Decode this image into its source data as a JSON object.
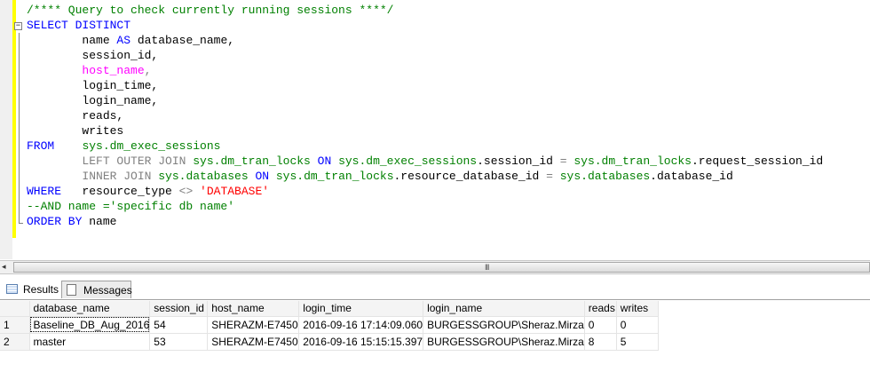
{
  "editor": {
    "fold_icon": "collapse-minus-icon",
    "lines": [
      [
        {
          "t": "/**** Query to check currently running sessions ****/",
          "c": "cm"
        }
      ],
      [
        {
          "t": "SELECT DISTINCT",
          "c": "kw"
        }
      ],
      [
        {
          "t": "        name ",
          "c": "plain"
        },
        {
          "t": "AS",
          "c": "kw"
        },
        {
          "t": " database_name,",
          "c": "plain"
        }
      ],
      [
        {
          "t": "        session_id,",
          "c": "plain"
        }
      ],
      [
        {
          "t": "        ",
          "c": "plain"
        },
        {
          "t": "host_name",
          "c": "fn"
        },
        {
          "t": ",",
          "c": "gray"
        }
      ],
      [
        {
          "t": "        login_time,",
          "c": "plain"
        }
      ],
      [
        {
          "t": "        login_name,",
          "c": "plain"
        }
      ],
      [
        {
          "t": "        reads,",
          "c": "plain"
        }
      ],
      [
        {
          "t": "        writes",
          "c": "plain"
        }
      ],
      [
        {
          "t": "FROM",
          "c": "kw"
        },
        {
          "t": "    ",
          "c": "plain"
        },
        {
          "t": "sys.dm_exec_sessions",
          "c": "sys"
        }
      ],
      [
        {
          "t": "        LEFT OUTER JOIN ",
          "c": "gray"
        },
        {
          "t": "sys.dm_tran_locks",
          "c": "sys"
        },
        {
          "t": " ON ",
          "c": "kw"
        },
        {
          "t": "sys.dm_exec_sessions",
          "c": "sys"
        },
        {
          "t": ".session_id ",
          "c": "plain"
        },
        {
          "t": "=",
          "c": "gray"
        },
        {
          "t": " sys.dm_tran_locks",
          "c": "sys"
        },
        {
          "t": ".request_session_id",
          "c": "plain"
        }
      ],
      [
        {
          "t": "        INNER JOIN ",
          "c": "gray"
        },
        {
          "t": "sys.databases",
          "c": "sys"
        },
        {
          "t": " ON ",
          "c": "kw"
        },
        {
          "t": "sys.dm_tran_locks",
          "c": "sys"
        },
        {
          "t": ".resource_database_id ",
          "c": "plain"
        },
        {
          "t": "=",
          "c": "gray"
        },
        {
          "t": " sys.databases",
          "c": "sys"
        },
        {
          "t": ".database_id",
          "c": "plain"
        }
      ],
      [
        {
          "t": "WHERE",
          "c": "kw"
        },
        {
          "t": "   resource_type ",
          "c": "plain"
        },
        {
          "t": "<>",
          "c": "gray"
        },
        {
          "t": " 'DATABASE'",
          "c": "str"
        }
      ],
      [
        {
          "t": "--AND name ='specific db name'",
          "c": "cm"
        }
      ],
      [
        {
          "t": "ORDER BY",
          "c": "kw"
        },
        {
          "t": " name",
          "c": "plain"
        }
      ]
    ]
  },
  "scrollbar": {
    "left_arrow": "◂",
    "grip": "III"
  },
  "tabs": [
    {
      "label": "Results",
      "icon": "grid-icon",
      "active": true
    },
    {
      "label": "Messages",
      "icon": "messages-icon",
      "active": false
    }
  ],
  "results": {
    "columns": [
      "database_name",
      "session_id",
      "host_name",
      "login_time",
      "login_name",
      "reads",
      "writes"
    ],
    "rows": [
      [
        "1",
        "Baseline_DB_Aug_2016",
        "54",
        "SHERAZM-E7450",
        "2016-09-16 17:14:09.060",
        "BURGESSGROUP\\Sheraz.Mirza",
        "0",
        "0"
      ],
      [
        "2",
        "master",
        "53",
        "SHERAZM-E7450",
        "2016-09-16 15:15:15.397",
        "BURGESSGROUP\\Sheraz.Mirza",
        "8",
        "5"
      ]
    ]
  },
  "colors": {
    "keyword": "#0000ff",
    "system_object": "#008000",
    "comment": "#008000",
    "string": "#ff0000",
    "function": "#ff00ff",
    "operator": "#808080",
    "change_bar": "#ffff00"
  }
}
